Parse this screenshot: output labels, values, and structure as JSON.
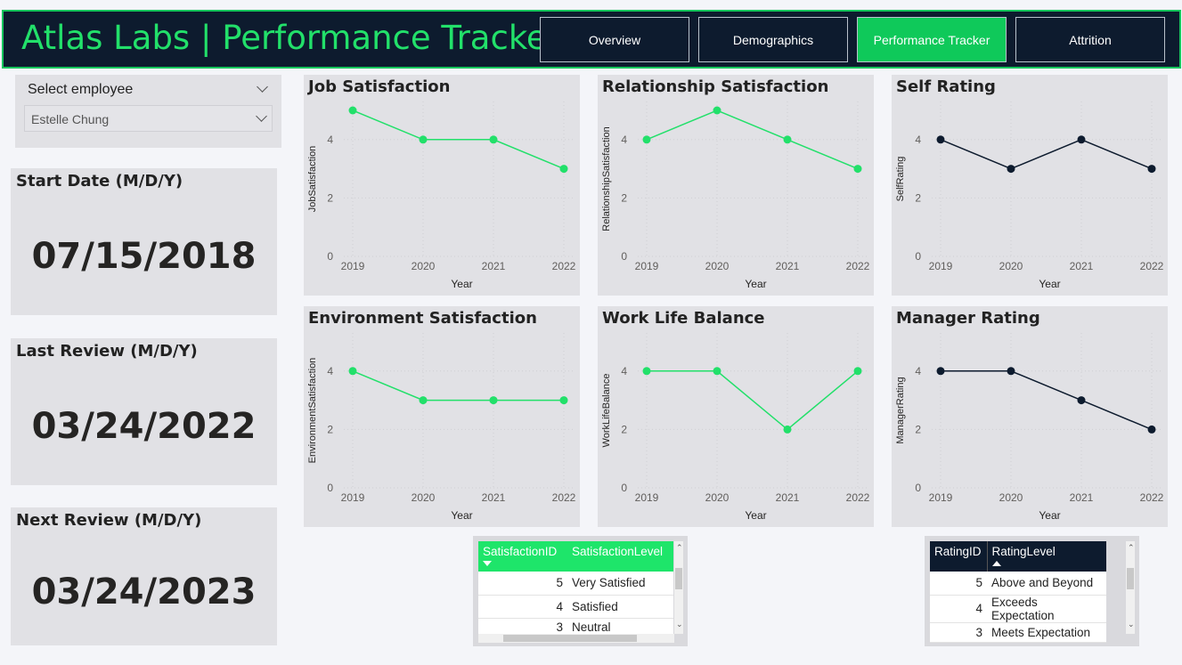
{
  "header": {
    "title": "Atlas Labs | Performance Tracker",
    "nav": [
      {
        "label": "Overview",
        "active": false
      },
      {
        "label": "Demographics",
        "active": false
      },
      {
        "label": "Performance Tracker",
        "active": true
      },
      {
        "label": "Attrition",
        "active": false
      }
    ]
  },
  "slicer": {
    "title": "Select employee",
    "selected": "Estelle Chung"
  },
  "cards": {
    "start": {
      "title": "Start Date (M/D/Y)",
      "value": "07/15/2018"
    },
    "last": {
      "title": "Last Review (M/D/Y)",
      "value": "03/24/2022"
    },
    "next": {
      "title": "Next Review (M/D/Y)",
      "value": "03/24/2023"
    }
  },
  "colors": {
    "green": "#22e06a",
    "navy": "#0d1b2e"
  },
  "chart_data": [
    {
      "id": "job",
      "type": "line",
      "title": "Job Satisfaction",
      "xlabel": "Year",
      "ylabel": "JobSatisfaction",
      "x": [
        "2019",
        "2020",
        "2021",
        "2022"
      ],
      "values": [
        5,
        4,
        4,
        3
      ],
      "yticks": [
        "0",
        "2",
        "4"
      ],
      "ylim": [
        0,
        5
      ],
      "color": "#22e06a"
    },
    {
      "id": "rel",
      "type": "line",
      "title": "Relationship Satisfaction",
      "xlabel": "Year",
      "ylabel": "RelationshipSatisfaction",
      "x": [
        "2019",
        "2020",
        "2021",
        "2022"
      ],
      "values": [
        4,
        5,
        4,
        3
      ],
      "yticks": [
        "0",
        "2",
        "4"
      ],
      "ylim": [
        0,
        5
      ],
      "color": "#22e06a"
    },
    {
      "id": "self",
      "type": "line",
      "title": "Self Rating",
      "xlabel": "Year",
      "ylabel": "SelfRating",
      "x": [
        "2019",
        "2020",
        "2021",
        "2022"
      ],
      "values": [
        4,
        3,
        4,
        3
      ],
      "yticks": [
        "0",
        "2",
        "4"
      ],
      "ylim": [
        0,
        5
      ],
      "color": "#0d1b2e"
    },
    {
      "id": "env",
      "type": "line",
      "title": "Environment Satisfaction",
      "xlabel": "Year",
      "ylabel": "EnvironmentSatisfaction",
      "x": [
        "2019",
        "2020",
        "2021",
        "2022"
      ],
      "values": [
        4,
        3,
        3,
        3
      ],
      "yticks": [
        "0",
        "2",
        "4"
      ],
      "ylim": [
        0,
        5
      ],
      "color": "#22e06a"
    },
    {
      "id": "wlb",
      "type": "line",
      "title": "Work Life Balance",
      "xlabel": "Year",
      "ylabel": "WorkLifeBalance",
      "x": [
        "2019",
        "2020",
        "2021",
        "2022"
      ],
      "values": [
        4,
        4,
        2,
        4
      ],
      "yticks": [
        "0",
        "2",
        "4"
      ],
      "ylim": [
        0,
        5
      ],
      "color": "#22e06a"
    },
    {
      "id": "mgr",
      "type": "line",
      "title": "Manager Rating",
      "xlabel": "Year",
      "ylabel": "ManagerRating",
      "x": [
        "2019",
        "2020",
        "2021",
        "2022"
      ],
      "values": [
        4,
        4,
        3,
        2
      ],
      "yticks": [
        "0",
        "2",
        "4"
      ],
      "ylim": [
        0,
        5
      ],
      "color": "#0d1b2e"
    }
  ],
  "satisfaction_table": {
    "headers": [
      "SatisfactionID",
      "SatisfactionLevel"
    ],
    "rows": [
      [
        "5",
        "Very Satisfied"
      ],
      [
        "4",
        "Satisfied"
      ],
      [
        "3",
        "Neutral"
      ]
    ]
  },
  "rating_table": {
    "headers": [
      "RatingID",
      "RatingLevel"
    ],
    "rows": [
      [
        "5",
        "Above and Beyond"
      ],
      [
        "4",
        "Exceeds Expectation"
      ],
      [
        "3",
        "Meets Expectation"
      ]
    ]
  }
}
